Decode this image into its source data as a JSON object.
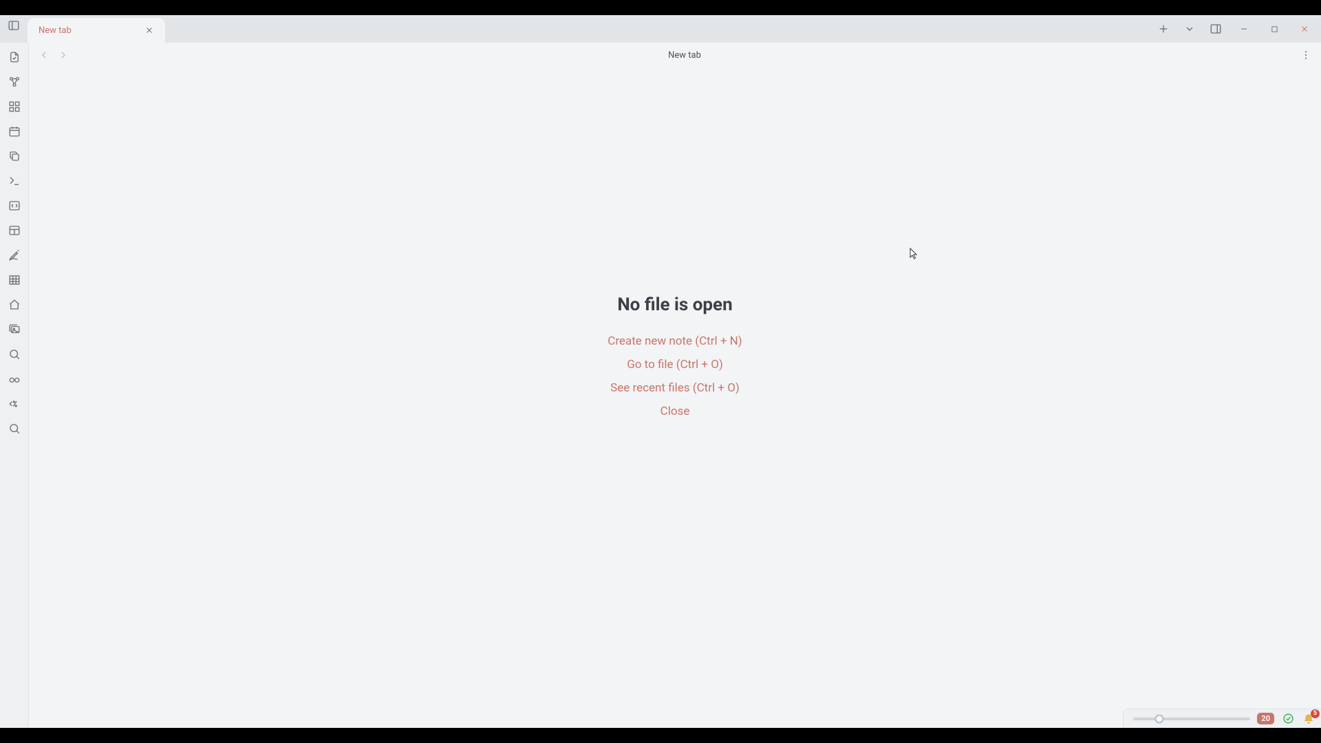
{
  "tab": {
    "title": "New tab"
  },
  "content_header": {
    "title": "New tab"
  },
  "empty": {
    "heading": "No file is open",
    "create": "Create new note (Ctrl + N)",
    "goto": "Go to file (Ctrl + O)",
    "recent": "See recent files (Ctrl + O)",
    "close": "Close"
  },
  "status": {
    "slider_value": "20",
    "slider_percent": 22,
    "bell_count": "5"
  },
  "icons": {
    "sidebar_toggle": "panel-left-icon",
    "new_tab": "plus-icon",
    "tab_dropdown": "chevron-down-icon",
    "panel_right": "panel-right-icon",
    "minimize": "minimize-icon",
    "maximize": "maximize-icon",
    "close_window": "close-icon"
  }
}
